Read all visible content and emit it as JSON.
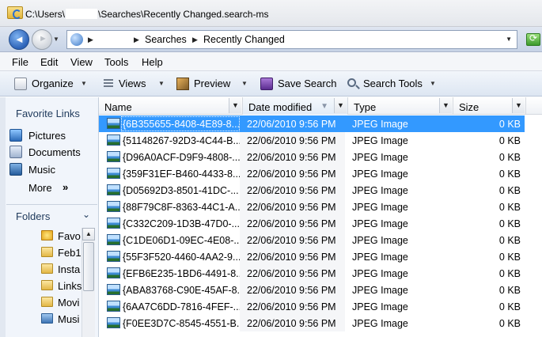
{
  "window": {
    "title_prefix": "C:\\Users\\",
    "title_suffix": "\\Searches\\Recently Changed.search-ms"
  },
  "address": {
    "crumbs": [
      "Searches",
      "Recently Changed"
    ]
  },
  "menu": [
    "File",
    "Edit",
    "View",
    "Tools",
    "Help"
  ],
  "toolbar": {
    "organize": "Organize",
    "views": "Views",
    "preview": "Preview",
    "save_search": "Save Search",
    "search_tools": "Search Tools"
  },
  "nav": {
    "favorite_links_title": "Favorite Links",
    "favorites": [
      "Pictures",
      "Documents",
      "Music"
    ],
    "more": "More",
    "more_arrows": "»",
    "folders_title": "Folders",
    "tree": [
      "Favo",
      "Feb1",
      "Insta",
      "Links",
      "Movi",
      "Musi"
    ]
  },
  "columns": {
    "name": "Name",
    "date": "Date modified",
    "type": "Type",
    "size": "Size"
  },
  "files": [
    {
      "name": "{6B355655-8408-4E89-8...",
      "date": "22/06/2010 9:56 PM",
      "type": "JPEG Image",
      "size": "0 KB",
      "selected": true
    },
    {
      "name": "{51148267-92D3-4C44-B...",
      "date": "22/06/2010 9:56 PM",
      "type": "JPEG Image",
      "size": "0 KB"
    },
    {
      "name": "{D96A0ACF-D9F9-4808-...",
      "date": "22/06/2010 9:56 PM",
      "type": "JPEG Image",
      "size": "0 KB"
    },
    {
      "name": "{359F31EF-B460-4433-8...",
      "date": "22/06/2010 9:56 PM",
      "type": "JPEG Image",
      "size": "0 KB"
    },
    {
      "name": "{D05692D3-8501-41DC-...",
      "date": "22/06/2010 9:56 PM",
      "type": "JPEG Image",
      "size": "0 KB"
    },
    {
      "name": "{88F79C8F-8363-44C1-A...",
      "date": "22/06/2010 9:56 PM",
      "type": "JPEG Image",
      "size": "0 KB"
    },
    {
      "name": "{C332C209-1D3B-47D0-...",
      "date": "22/06/2010 9:56 PM",
      "type": "JPEG Image",
      "size": "0 KB"
    },
    {
      "name": "{C1DE06D1-09EC-4E08-...",
      "date": "22/06/2010 9:56 PM",
      "type": "JPEG Image",
      "size": "0 KB"
    },
    {
      "name": "{55F3F520-4460-4AA2-9...",
      "date": "22/06/2010 9:56 PM",
      "type": "JPEG Image",
      "size": "0 KB"
    },
    {
      "name": "{EFB6E235-1BD6-4491-8...",
      "date": "22/06/2010 9:56 PM",
      "type": "JPEG Image",
      "size": "0 KB"
    },
    {
      "name": "{ABA83768-C90E-45AF-8...",
      "date": "22/06/2010 9:56 PM",
      "type": "JPEG Image",
      "size": "0 KB"
    },
    {
      "name": "{6AA7C6DD-7816-4FEF-...",
      "date": "22/06/2010 9:56 PM",
      "type": "JPEG Image",
      "size": "0 KB"
    },
    {
      "name": "{F0EE3D7C-8545-4551-B...",
      "date": "22/06/2010 9:56 PM",
      "type": "JPEG Image",
      "size": "0 KB"
    }
  ],
  "colors": {
    "selection": "#3399ff",
    "nav_bg": "#f1f5fb"
  }
}
